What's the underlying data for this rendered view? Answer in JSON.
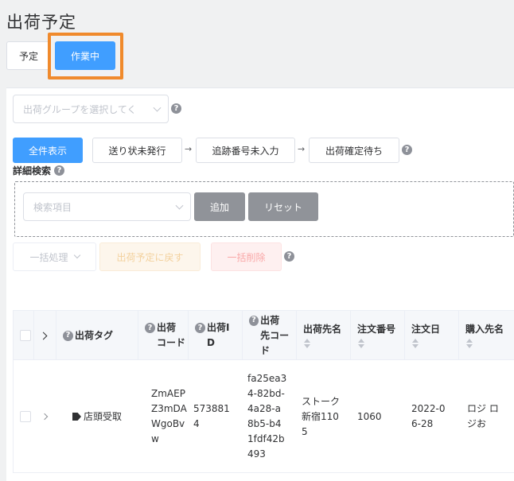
{
  "page": {
    "title": "出荷予定"
  },
  "tabs": [
    {
      "label": "予定"
    },
    {
      "label": "作業中"
    }
  ],
  "group_select": {
    "placeholder": "出荷グループを選択してく",
    "help": "?"
  },
  "filters": {
    "all": "全件表示",
    "step1": "送り状未発行",
    "step2": "追跡番号未入力",
    "step3": "出荷確定待ち",
    "arrow": "→",
    "help": "?"
  },
  "detail_search": {
    "label": "詳細検索",
    "help": "?",
    "item_placeholder": "検索項目",
    "add": "追加",
    "reset": "リセット"
  },
  "bulk": {
    "process": "一括処理",
    "return": "出荷予定に戻す",
    "delete": "一括削除",
    "help": "?"
  },
  "table": {
    "headers": {
      "tag": "出荷タグ",
      "ship_code": "出荷\nコード",
      "ship_id": "出荷I\nD",
      "dest_code": "出荷\n先コード",
      "dest_name": "出荷先名",
      "order_no": "注文番号",
      "order_date": "注文日",
      "buyer": "購入先名"
    },
    "rows": [
      {
        "tag": "店頭受取",
        "ship_code": "ZmAEP\nZ3mDA\nWgoBv\nw",
        "ship_id": "573881\n4",
        "dest_code": "fa25ea3\n4-82bd-\n4a28-a\n8b5-b4\n1fdf42b\n493",
        "dest_name": "ストーク\n新宿110\n5",
        "order_no": "1060",
        "order_date": "2022-0\n6-28",
        "buyer": "ロジ ロ\nジお"
      }
    ]
  },
  "colors": {
    "primary": "#409eff",
    "highlight": "#f08a2c",
    "gray": "#909399"
  }
}
